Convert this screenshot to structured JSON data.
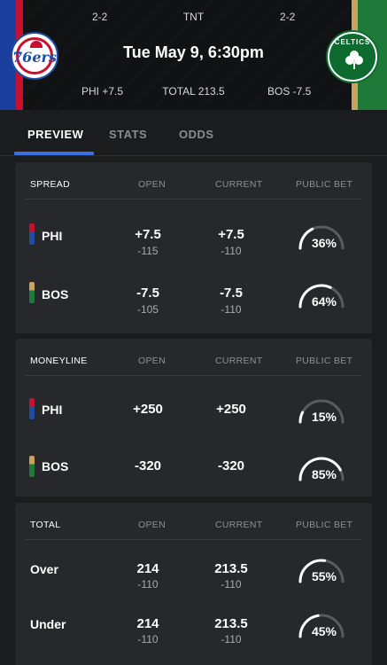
{
  "header": {
    "left_record": "2-2",
    "network": "TNT",
    "right_record": "2-2",
    "title": "Tue May 9, 6:30pm",
    "left_spread": "PHI +7.5",
    "total": "TOTAL 213.5",
    "right_spread": "BOS -7.5",
    "left_logo_text": "76ers",
    "right_logo_text": "CELTICS"
  },
  "tabs": [
    "PREVIEW",
    "STATS",
    "ODDS"
  ],
  "columns": {
    "open": "OPEN",
    "current": "CURRENT",
    "public": "PUBLIC BET"
  },
  "spread": {
    "title": "SPREAD",
    "rows": [
      {
        "team": "PHI",
        "open": "+7.5",
        "open_odds": "-115",
        "current": "+7.5",
        "current_odds": "-110",
        "public": "36%",
        "public_value": 36
      },
      {
        "team": "BOS",
        "open": "-7.5",
        "open_odds": "-105",
        "current": "-7.5",
        "current_odds": "-110",
        "public": "64%",
        "public_value": 64
      }
    ]
  },
  "moneyline": {
    "title": "MONEYLINE",
    "rows": [
      {
        "team": "PHI",
        "open": "+250",
        "current": "+250",
        "public": "15%",
        "public_value": 15
      },
      {
        "team": "BOS",
        "open": "-320",
        "current": "-320",
        "public": "85%",
        "public_value": 85
      }
    ]
  },
  "total": {
    "title": "TOTAL",
    "rows": [
      {
        "team": "Over",
        "open": "214",
        "open_odds": "-110",
        "current": "213.5",
        "current_odds": "-110",
        "public": "55%",
        "public_value": 55
      },
      {
        "team": "Under",
        "open": "214",
        "open_odds": "-110",
        "current": "213.5",
        "current_odds": "-110",
        "public": "45%",
        "public_value": 45
      }
    ]
  },
  "colors": {
    "phi_top": "#c8102e",
    "phi_bottom": "#1d4ea2",
    "bos_top": "#c9a25b",
    "bos_bottom": "#1f7a3a",
    "tab_accent": "#3b6fe0",
    "gauge_track": "#5a5b5f",
    "gauge_fill": "#ffffff"
  }
}
